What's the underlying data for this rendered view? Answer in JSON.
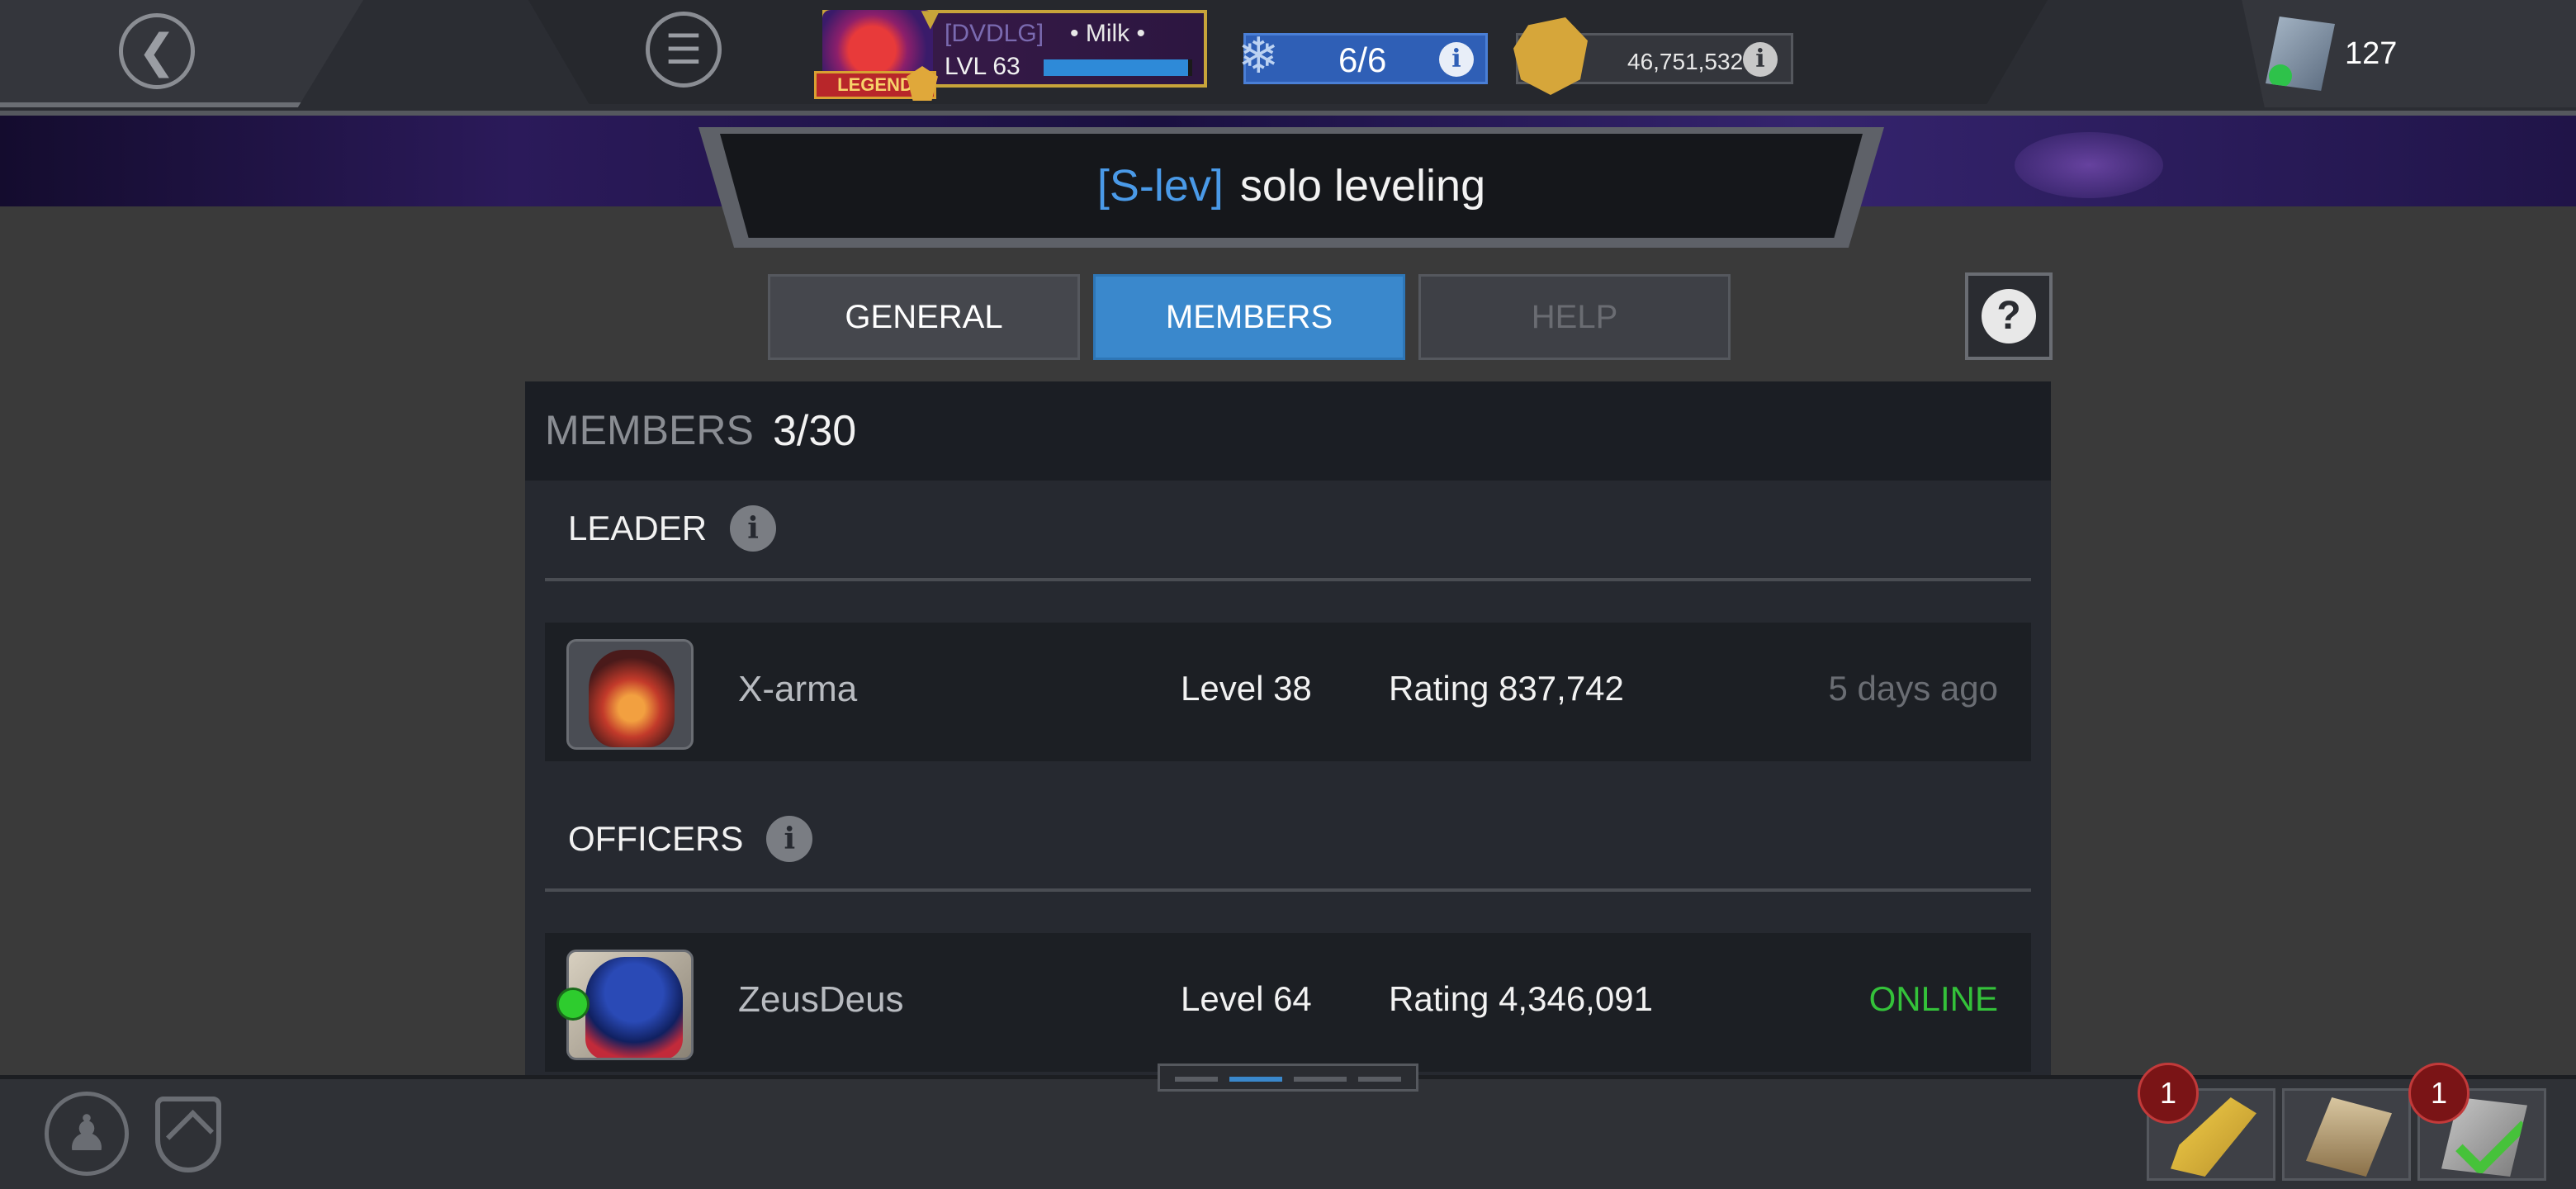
{
  "topbar": {
    "back_icon": "chevron-left-icon",
    "menu_icon": "menu-lines-icon",
    "profile": {
      "tag": "[DVDLG]",
      "name": "• Milk •",
      "level": "LVL 63",
      "xp_fraction": 0.97,
      "rank_badge": "LEGEND"
    },
    "energy": {
      "value": "6/6",
      "icon": "energy-crystal-icon"
    },
    "gold": {
      "value": "46,751,532",
      "icon": "gold-icon"
    },
    "units": {
      "value": "127",
      "icon": "units-icon"
    }
  },
  "alliance": {
    "tag": "[S-lev]",
    "name": "solo leveling"
  },
  "tabs": {
    "general": "GENERAL",
    "members": "MEMBERS",
    "help": "HELP",
    "active": "members"
  },
  "members_panel": {
    "label": "MEMBERS",
    "count": "3/30",
    "leader_section": "LEADER",
    "officers_section": "OFFICERS",
    "leader": {
      "name": "X-arma",
      "level": "Level 38",
      "rating": "Rating 837,742",
      "status": "5 days ago",
      "online": false
    },
    "officer": {
      "name": "ZeusDeus",
      "level": "Level 64",
      "rating": "Rating 4,346,091",
      "status": "ONLINE",
      "online": true
    }
  },
  "bottombar": {
    "pager_active_index": 1,
    "pager_count": 4,
    "quest_badge": "1",
    "done_badge": "1"
  },
  "colors": {
    "accent_blue": "#3a88cc",
    "online_green": "#34c23a",
    "badge_red": "#7a1416"
  }
}
